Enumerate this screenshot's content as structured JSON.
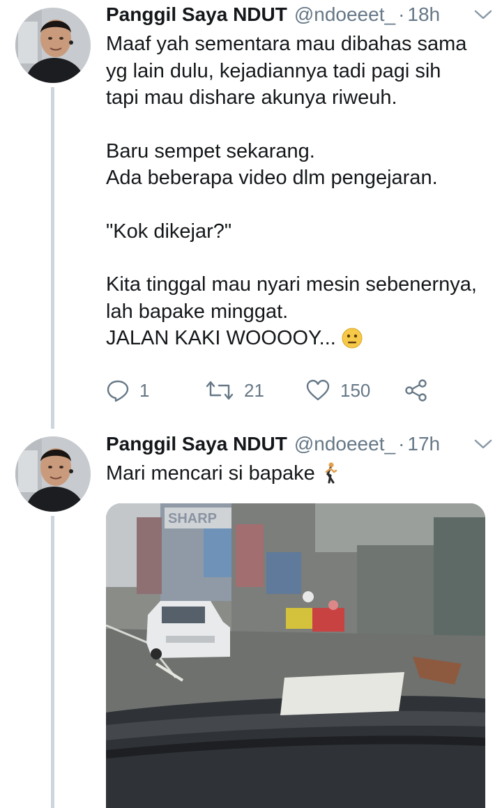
{
  "tweets": [
    {
      "name": "Panggil Saya NDUT",
      "handle": "@ndoeeet_",
      "separator": "·",
      "time": "18h",
      "lines": [
        "Maaf yah sementara mau dibahas sama",
        "yg lain dulu, kejadiannya tadi pagi sih",
        "tapi mau dishare akunya riweuh.",
        "",
        "Baru sempet sekarang.",
        "Ada beberapa video dlm pengejaran.",
        "",
        "\"Kok dikejar?\"",
        "",
        "Kita tinggal mau nyari mesin sebenernya,",
        "lah bapake minggat.",
        "JALAN KAKI WOOOOY..."
      ],
      "trailing_emoji": "neutral-face-emoji",
      "actions": {
        "reply_count": "1",
        "retweet_count": "21",
        "like_count": "150"
      }
    },
    {
      "name": "Panggil Saya NDUT",
      "handle": "@ndoeeet_",
      "separator": "·",
      "time": "17h",
      "text": "Mari mencari si bapake",
      "trailing_emoji": "person-walking-emoji",
      "media": {
        "type": "video-still",
        "sign_text": "SHARP"
      }
    }
  ],
  "colors": {
    "text": "#14171a",
    "secondary": "#657786",
    "thread_line": "#cdd6dd"
  },
  "icons": [
    "reply-icon",
    "retweet-icon",
    "like-icon",
    "share-icon",
    "chevron-down-icon"
  ]
}
